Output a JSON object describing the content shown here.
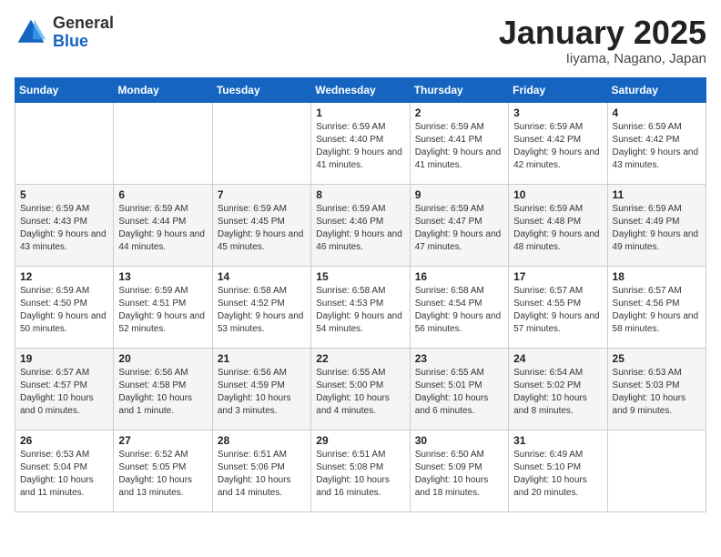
{
  "header": {
    "logo_general": "General",
    "logo_blue": "Blue",
    "month_title": "January 2025",
    "location": "Iiyama, Nagano, Japan"
  },
  "weekdays": [
    "Sunday",
    "Monday",
    "Tuesday",
    "Wednesday",
    "Thursday",
    "Friday",
    "Saturday"
  ],
  "weeks": [
    [
      {
        "day": "",
        "info": ""
      },
      {
        "day": "",
        "info": ""
      },
      {
        "day": "",
        "info": ""
      },
      {
        "day": "1",
        "info": "Sunrise: 6:59 AM\nSunset: 4:40 PM\nDaylight: 9 hours and 41 minutes."
      },
      {
        "day": "2",
        "info": "Sunrise: 6:59 AM\nSunset: 4:41 PM\nDaylight: 9 hours and 41 minutes."
      },
      {
        "day": "3",
        "info": "Sunrise: 6:59 AM\nSunset: 4:42 PM\nDaylight: 9 hours and 42 minutes."
      },
      {
        "day": "4",
        "info": "Sunrise: 6:59 AM\nSunset: 4:42 PM\nDaylight: 9 hours and 43 minutes."
      }
    ],
    [
      {
        "day": "5",
        "info": "Sunrise: 6:59 AM\nSunset: 4:43 PM\nDaylight: 9 hours and 43 minutes."
      },
      {
        "day": "6",
        "info": "Sunrise: 6:59 AM\nSunset: 4:44 PM\nDaylight: 9 hours and 44 minutes."
      },
      {
        "day": "7",
        "info": "Sunrise: 6:59 AM\nSunset: 4:45 PM\nDaylight: 9 hours and 45 minutes."
      },
      {
        "day": "8",
        "info": "Sunrise: 6:59 AM\nSunset: 4:46 PM\nDaylight: 9 hours and 46 minutes."
      },
      {
        "day": "9",
        "info": "Sunrise: 6:59 AM\nSunset: 4:47 PM\nDaylight: 9 hours and 47 minutes."
      },
      {
        "day": "10",
        "info": "Sunrise: 6:59 AM\nSunset: 4:48 PM\nDaylight: 9 hours and 48 minutes."
      },
      {
        "day": "11",
        "info": "Sunrise: 6:59 AM\nSunset: 4:49 PM\nDaylight: 9 hours and 49 minutes."
      }
    ],
    [
      {
        "day": "12",
        "info": "Sunrise: 6:59 AM\nSunset: 4:50 PM\nDaylight: 9 hours and 50 minutes."
      },
      {
        "day": "13",
        "info": "Sunrise: 6:59 AM\nSunset: 4:51 PM\nDaylight: 9 hours and 52 minutes."
      },
      {
        "day": "14",
        "info": "Sunrise: 6:58 AM\nSunset: 4:52 PM\nDaylight: 9 hours and 53 minutes."
      },
      {
        "day": "15",
        "info": "Sunrise: 6:58 AM\nSunset: 4:53 PM\nDaylight: 9 hours and 54 minutes."
      },
      {
        "day": "16",
        "info": "Sunrise: 6:58 AM\nSunset: 4:54 PM\nDaylight: 9 hours and 56 minutes."
      },
      {
        "day": "17",
        "info": "Sunrise: 6:57 AM\nSunset: 4:55 PM\nDaylight: 9 hours and 57 minutes."
      },
      {
        "day": "18",
        "info": "Sunrise: 6:57 AM\nSunset: 4:56 PM\nDaylight: 9 hours and 58 minutes."
      }
    ],
    [
      {
        "day": "19",
        "info": "Sunrise: 6:57 AM\nSunset: 4:57 PM\nDaylight: 10 hours and 0 minutes."
      },
      {
        "day": "20",
        "info": "Sunrise: 6:56 AM\nSunset: 4:58 PM\nDaylight: 10 hours and 1 minute."
      },
      {
        "day": "21",
        "info": "Sunrise: 6:56 AM\nSunset: 4:59 PM\nDaylight: 10 hours and 3 minutes."
      },
      {
        "day": "22",
        "info": "Sunrise: 6:55 AM\nSunset: 5:00 PM\nDaylight: 10 hours and 4 minutes."
      },
      {
        "day": "23",
        "info": "Sunrise: 6:55 AM\nSunset: 5:01 PM\nDaylight: 10 hours and 6 minutes."
      },
      {
        "day": "24",
        "info": "Sunrise: 6:54 AM\nSunset: 5:02 PM\nDaylight: 10 hours and 8 minutes."
      },
      {
        "day": "25",
        "info": "Sunrise: 6:53 AM\nSunset: 5:03 PM\nDaylight: 10 hours and 9 minutes."
      }
    ],
    [
      {
        "day": "26",
        "info": "Sunrise: 6:53 AM\nSunset: 5:04 PM\nDaylight: 10 hours and 11 minutes."
      },
      {
        "day": "27",
        "info": "Sunrise: 6:52 AM\nSunset: 5:05 PM\nDaylight: 10 hours and 13 minutes."
      },
      {
        "day": "28",
        "info": "Sunrise: 6:51 AM\nSunset: 5:06 PM\nDaylight: 10 hours and 14 minutes."
      },
      {
        "day": "29",
        "info": "Sunrise: 6:51 AM\nSunset: 5:08 PM\nDaylight: 10 hours and 16 minutes."
      },
      {
        "day": "30",
        "info": "Sunrise: 6:50 AM\nSunset: 5:09 PM\nDaylight: 10 hours and 18 minutes."
      },
      {
        "day": "31",
        "info": "Sunrise: 6:49 AM\nSunset: 5:10 PM\nDaylight: 10 hours and 20 minutes."
      },
      {
        "day": "",
        "info": ""
      }
    ]
  ]
}
